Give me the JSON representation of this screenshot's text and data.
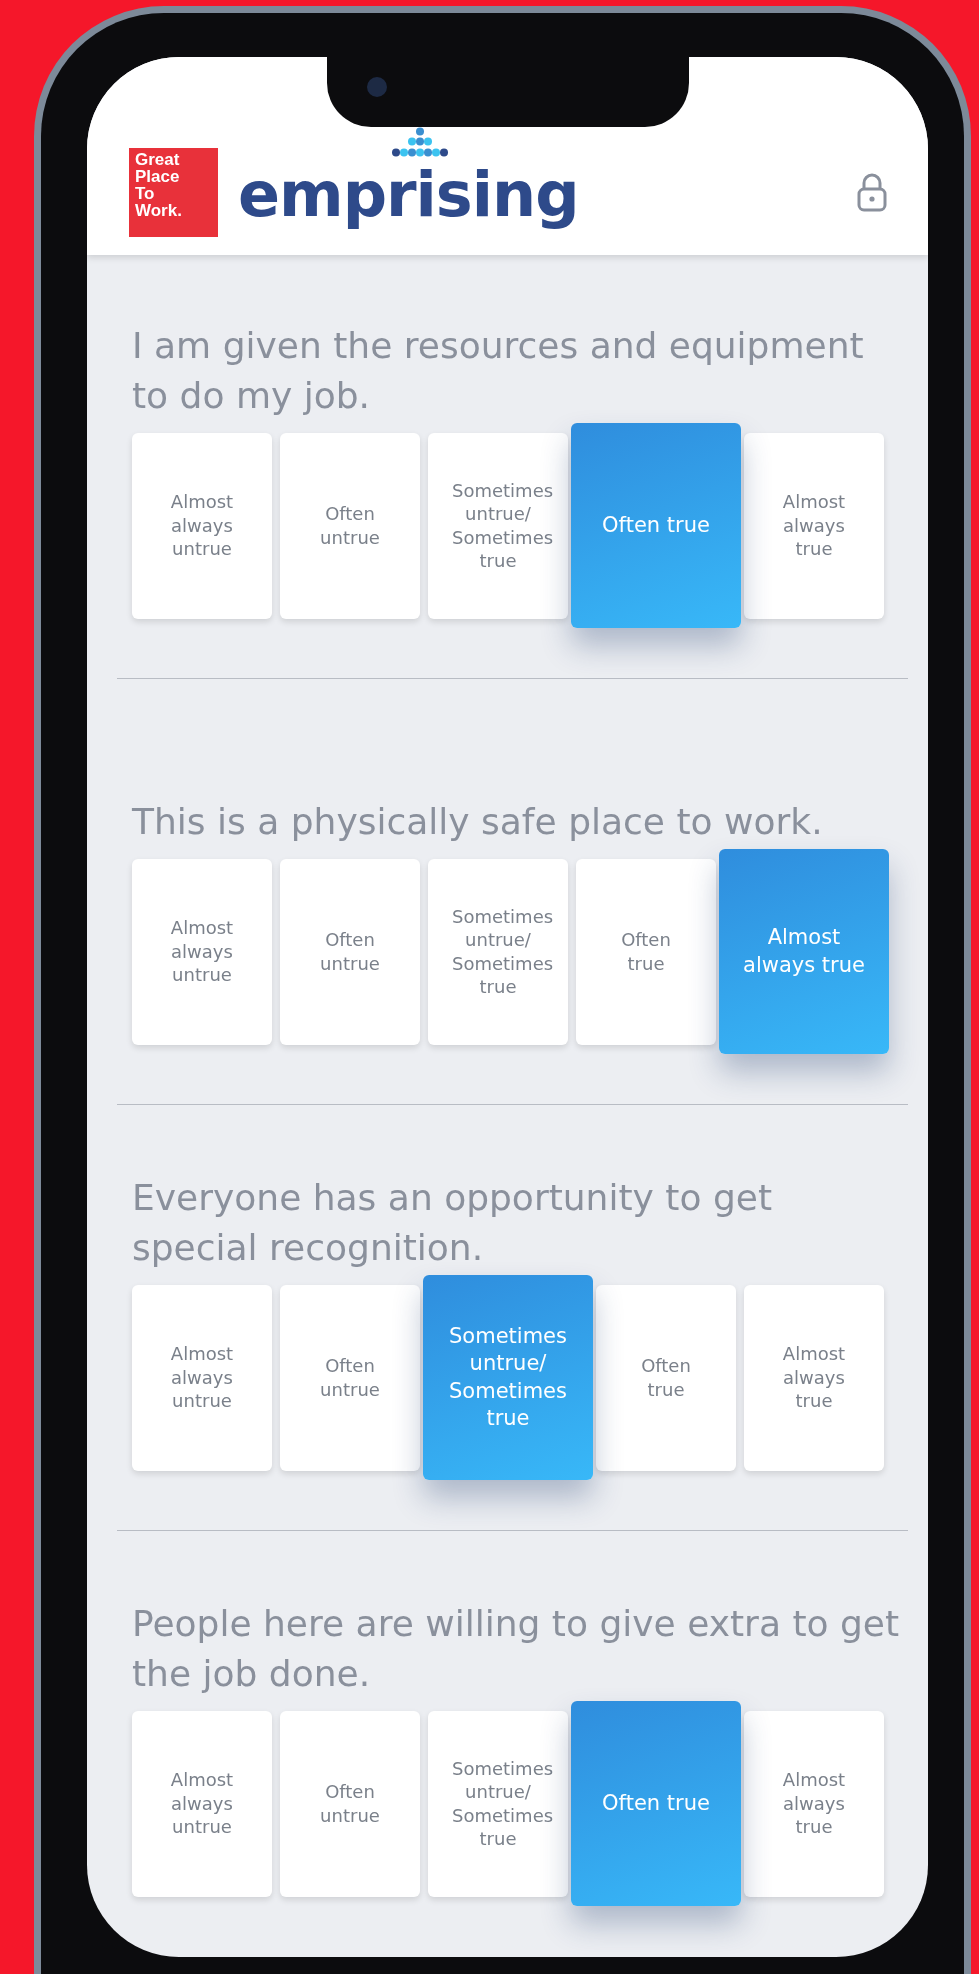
{
  "brand": {
    "logo_text": "Great Place To Work.",
    "name": "emprising"
  },
  "questions": [
    {
      "text": "I am given the resources and equipment to do my job.",
      "options": [
        {
          "label": "Almost always untrue",
          "selected": false
        },
        {
          "label": "Often untrue",
          "selected": false
        },
        {
          "label": "Sometimes untrue/ Sometimes true",
          "selected": false
        },
        {
          "label": "Often true",
          "selected": true
        },
        {
          "label": "Almost always true",
          "selected": false
        }
      ]
    },
    {
      "text": "This is a physically safe place to work.",
      "options": [
        {
          "label": "Almost always untrue",
          "selected": false
        },
        {
          "label": "Often untrue",
          "selected": false
        },
        {
          "label": "Sometimes untrue/ Sometimes true",
          "selected": false
        },
        {
          "label": "Often true",
          "selected": false
        },
        {
          "label": "Almost always true",
          "selected": true
        }
      ]
    },
    {
      "text": "Everyone has an opportunity to get special recognition.",
      "options": [
        {
          "label": "Almost always untrue",
          "selected": false
        },
        {
          "label": "Often untrue",
          "selected": false
        },
        {
          "label": "Sometimes untrue/ Sometimes true",
          "selected": true
        },
        {
          "label": "Often true",
          "selected": false
        },
        {
          "label": "Almost always true",
          "selected": false
        }
      ]
    },
    {
      "text": "People here are willing to give extra to get the job done.",
      "options": [
        {
          "label": "Almost always untrue",
          "selected": false
        },
        {
          "label": "Often untrue",
          "selected": false
        },
        {
          "label": "Sometimes untrue/ Sometimes true",
          "selected": false
        },
        {
          "label": "Often true",
          "selected": true
        },
        {
          "label": "Almost always true",
          "selected": false
        }
      ]
    }
  ]
}
